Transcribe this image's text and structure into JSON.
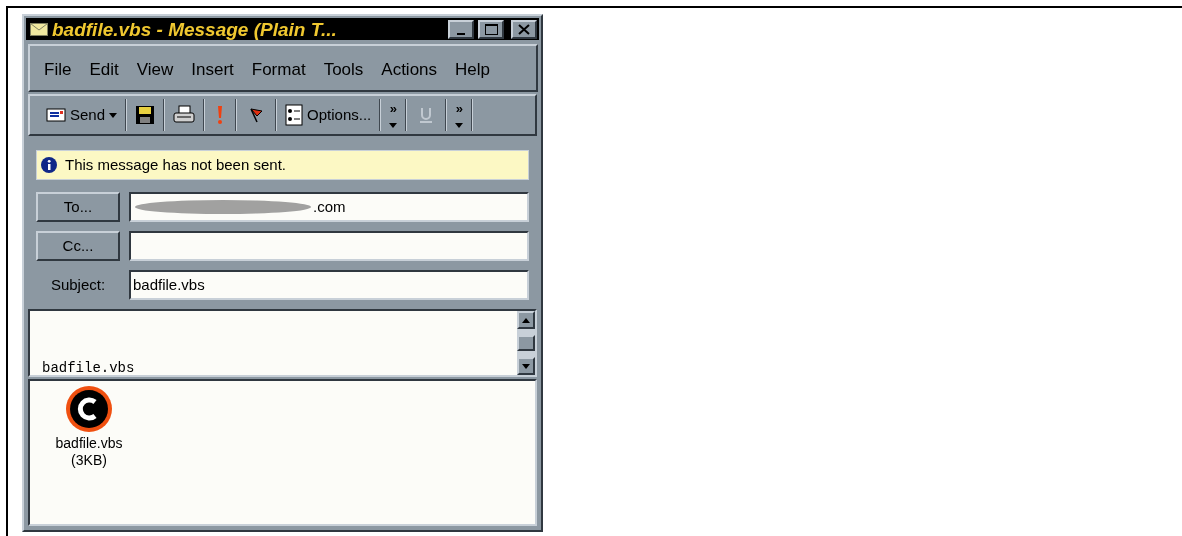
{
  "window": {
    "title": "badfile.vbs - Message (Plain T..."
  },
  "menu": [
    "File",
    "Edit",
    "View",
    "Insert",
    "Format",
    "Tools",
    "Actions",
    "Help"
  ],
  "toolbar": [
    {
      "kind": "send",
      "label": "Send"
    },
    {
      "kind": "save"
    },
    {
      "kind": "print"
    },
    {
      "kind": "importance"
    },
    {
      "kind": "flag"
    },
    {
      "kind": "options",
      "label": "Options..."
    },
    {
      "kind": "more",
      "label": "»"
    },
    {
      "kind": "underline"
    },
    {
      "kind": "more",
      "label": "»"
    }
  ],
  "info_bar": "This message has not been sent.",
  "fields": [
    {
      "kind": "button",
      "label": "To...",
      "value": ".com",
      "redacted": true
    },
    {
      "kind": "button",
      "label": "Cc...",
      "redacted": false
    },
    {
      "kind": "label",
      "label": "Subject:",
      "value": "badfile.vbs",
      "redacted": false
    }
  ],
  "body": "badfile.vbs",
  "attachments": [
    {
      "name": "badfile.vbs",
      "size": "(3KB)"
    }
  ]
}
